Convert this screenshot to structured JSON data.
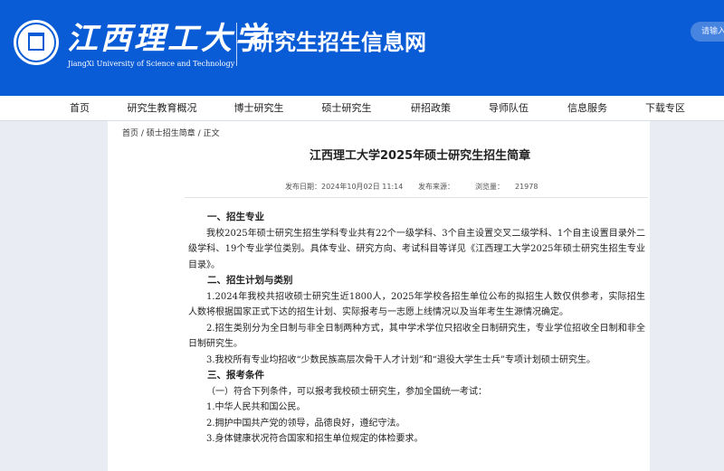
{
  "header": {
    "logo_cn": "江西理工大学",
    "logo_en": "JiangXi University of Science and Technology",
    "site_title": "研究生招生信息网",
    "search_placeholder": "请输入"
  },
  "nav": {
    "items": [
      "首页",
      "研究生教育概况",
      "博士研究生",
      "硕士研究生",
      "研招政策",
      "导师队伍",
      "信息服务",
      "下载专区"
    ]
  },
  "breadcrumb": {
    "home": "首页",
    "sep1": " / ",
    "section": "硕士招生简章",
    "sep2": " / ",
    "current": "正文"
  },
  "article": {
    "title": "江西理工大学2025年硕士研究生招生简章",
    "publish_date_label": "发布日期：",
    "publish_date": "2024年10月02日 11:14",
    "source_label": "发布来源：",
    "source": "",
    "views_label": "浏览量：",
    "views": "21978",
    "paragraphs": [
      {
        "heading": true,
        "text": "一、招生专业"
      },
      {
        "heading": false,
        "text": "我校2025年硕士研究生招生学科专业共有22个一级学科、3个自主设置交叉二级学科、1个自主设置目录外二级学科、19个专业学位类别。具体专业、研究方向、考试科目等详见《江西理工大学2025年硕士研究生招生专业目录》。"
      },
      {
        "heading": true,
        "text": "二、招生计划与类别"
      },
      {
        "heading": false,
        "text": "1.2024年我校共招收硕士研究生近1800人，2025年学校各招生单位公布的拟招生人数仅供参考，实际招生人数将根据国家正式下达的招生计划、实际报考与一志愿上线情况以及当年考生生源情况确定。"
      },
      {
        "heading": false,
        "text": "2.招生类别分为全日制与非全日制两种方式，其中学术学位只招收全日制研究生，专业学位招收全日制和非全日制研究生。"
      },
      {
        "heading": false,
        "text": "3.我校所有专业均招收“少数民族高层次骨干人才计划”和“退役大学生士兵”专项计划硕士研究生。"
      },
      {
        "heading": true,
        "text": "三、报考条件"
      },
      {
        "heading": false,
        "text": "（一）符合下列条件，可以报考我校硕士研究生，参加全国统一考试："
      },
      {
        "heading": false,
        "text": "1.中华人民共和国公民。"
      },
      {
        "heading": false,
        "text": "2.拥护中国共产党的领导，品德良好，遵纪守法。"
      },
      {
        "heading": false,
        "text": "3.身体健康状况符合国家和招生单位规定的体检要求。"
      }
    ]
  },
  "colors": {
    "brand_blue": "#0a5bd6",
    "page_bg": "#e9edf3",
    "content_bg": "#ffffff"
  }
}
